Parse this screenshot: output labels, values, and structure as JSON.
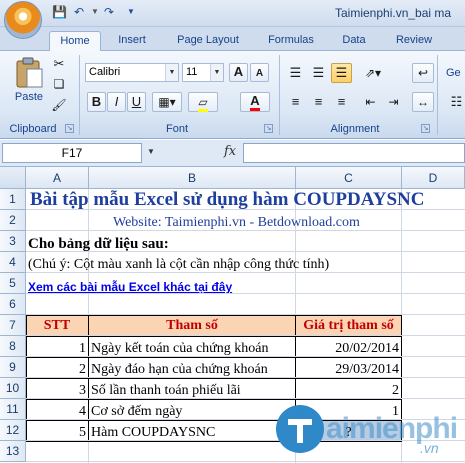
{
  "window": {
    "title": "Taimienphi.vn_bai ma"
  },
  "tabs": [
    "Home",
    "Insert",
    "Page Layout",
    "Formulas",
    "Data",
    "Review"
  ],
  "ribbon": {
    "clipboard": {
      "paste_label": "Paste",
      "group_label": "Clipboard"
    },
    "font": {
      "name": "Calibri",
      "size": "11",
      "group_label": "Font",
      "bold": "B",
      "italic": "I",
      "underline": "U",
      "grow": "A",
      "shrink": "A",
      "font_color_letter": "A"
    },
    "alignment": {
      "group_label": "Alignment",
      "more": "Ge"
    }
  },
  "formula_bar": {
    "name_box": "F17",
    "fx": "fx"
  },
  "grid": {
    "columns": [
      "A",
      "B",
      "C",
      "D"
    ],
    "rows": [
      "1",
      "2",
      "3",
      "4",
      "5",
      "6",
      "7",
      "8",
      "9",
      "10",
      "11",
      "12",
      "13"
    ]
  },
  "sheet": {
    "title": "Bài tập mẫu Excel sử dụng hàm COUPDAYSNC",
    "website": "Website: Taimienphi.vn - Betdownload.com",
    "intro": "Cho bảng dữ liệu sau:",
    "note": "(Chú ý: Cột màu xanh là cột cần nhập công thức tính)",
    "link": "Xem các bài mẫu Excel khác tại đây",
    "headers": {
      "stt": "STT",
      "param": "Tham số",
      "value": "Giá trị tham số"
    },
    "rows": [
      {
        "stt": "1",
        "param": "Ngày kết toán của chứng khoán",
        "value": "20/02/2014"
      },
      {
        "stt": "2",
        "param": "Ngày đáo hạn của chứng khoán",
        "value": "29/03/2014"
      },
      {
        "stt": "3",
        "param": "Số lần thanh toán phiếu lãi",
        "value": "2"
      },
      {
        "stt": "4",
        "param": "Cơ sở đếm ngày",
        "value": "1"
      },
      {
        "stt": "5",
        "param": "Hàm COUPDAYSNC",
        "value": "?"
      }
    ]
  },
  "colors": {
    "title": "#1f3f9f",
    "header_fill": "#fbd4b4",
    "header_text": "#c00000",
    "input_fill": "#b8cce4",
    "link": "#0000ee"
  },
  "watermark": {
    "brand": "aimienphi",
    "suffix": ".vn"
  }
}
